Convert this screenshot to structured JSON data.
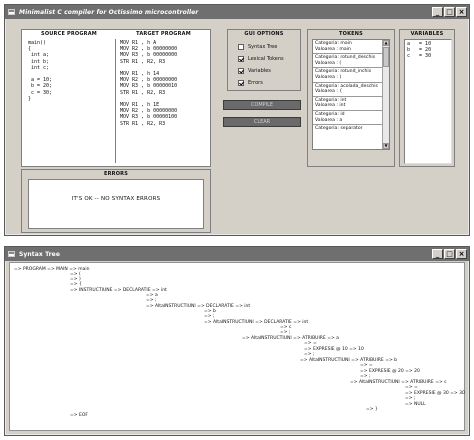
{
  "compiler_window": {
    "title": "Minimalist C compiler for Octissimo microcontroller",
    "controls": [
      "_",
      "□",
      "×"
    ]
  },
  "source_program": {
    "title": "SOURCE PROGRAM",
    "code": "main()\n{\n int a;\n int b;\n int c;\n\n a = 10;\n b = 20;\n c = 30;\n}"
  },
  "target_program": {
    "title": "TARGET PROGRAM",
    "code": "MOV R1 , h A\nMOV R2 , b 00000000\nMOV R3 , b 00000000\nSTR R1 , R2, R3\n\nMOV R1 , h 14\nMOV R2 , b 00000000\nMOV R3 , b 00000010\nSTR R1 , R2, R3\n\nMOV R1 , h 1E\nMOV R2 , b 00000000\nMOV R3 , b 00000100\nSTR R1 , R2, R3"
  },
  "gui_options": {
    "title": "GUI OPTIONS",
    "items": [
      {
        "label": "Syntax Tree",
        "checked": false
      },
      {
        "label": "Lexical Tokens",
        "checked": true
      },
      {
        "label": "Variables",
        "checked": true
      },
      {
        "label": "Errors",
        "checked": true
      }
    ],
    "button_1": "COMPILE",
    "button_2": "CLEAR"
  },
  "tokens": {
    "title": "TOKENS",
    "items": [
      {
        "cat": "Categoria: main",
        "val": "Valoarea : main"
      },
      {
        "cat": "Categoria: rotund_deschis",
        "val": "Valoarea : ("
      },
      {
        "cat": "Categoria: rotund_inchis",
        "val": "Valoarea : )"
      },
      {
        "cat": "Categoria: acolada_deschis",
        "val": "Valoarea : {"
      },
      {
        "cat": "Categoria: int",
        "val": "Valoarea : int"
      },
      {
        "cat": "Categoria: id",
        "val": "Valoarea : a"
      },
      {
        "cat": "Categoria: separator",
        "val": ""
      }
    ]
  },
  "variables": {
    "title": "VARIABLES",
    "items": [
      "a   = 10",
      "b   = 20",
      "c   = 30"
    ]
  },
  "errors": {
    "title": "ERRORS",
    "message": "IT'S OK -- NO SYNTAX ERRORS"
  },
  "syntax_window": {
    "title": "Syntax Tree",
    "controls": [
      "_",
      "□",
      "×"
    ]
  },
  "syntax_tree": {
    "nodes": [
      "=> PROGRAM => MAIN => main",
      "=> (",
      "=> )",
      "=> {",
      "=> INSTRUCTIUNE => DECLARATIE => int",
      "=> a",
      "=> ;",
      "=> AltaINSTRUCTIUNI => DECLARATIE => int",
      "=> b",
      "=> ;",
      "=> AltaINSTRUCTIUNI => DECLARATIE => int",
      "=> c",
      "=> ;",
      "=> AltaINSTRUCTIUNI => ATRIBUIRE => a",
      "=> =",
      "=> EXPRESIE @ 10 => 10",
      "=> ;",
      "=> AltaINSTRUCTIUNI => ATRIBUIRE => b",
      "=> =",
      "=> EXPRESIE @ 20 => 20",
      "=> ;",
      "=> AltaINSTRUCTIUNI => ATRIBUIRE => c",
      "=> =",
      "=> EXPRESIE @ 30 => 30",
      "=> ;",
      "=> NULL",
      "=> }",
      "=> EOF"
    ]
  }
}
